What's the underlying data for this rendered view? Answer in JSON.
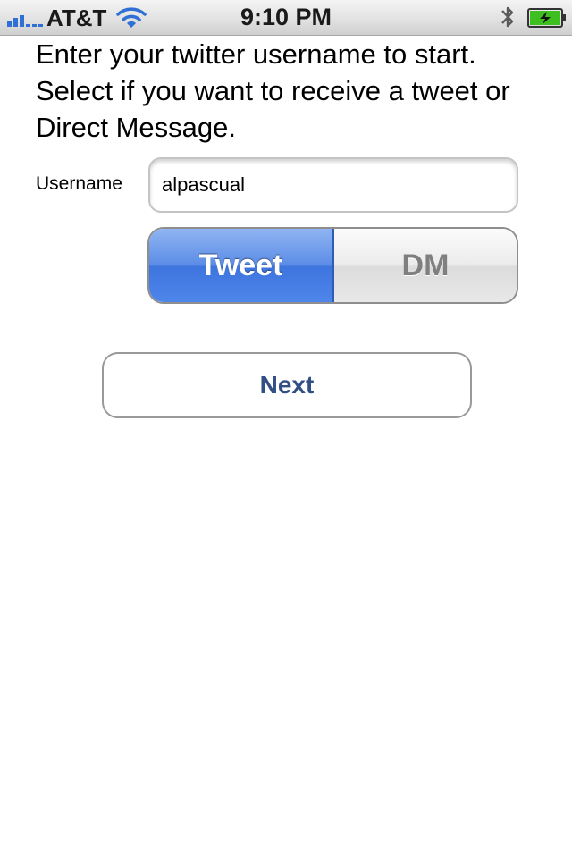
{
  "status_bar": {
    "carrier": "AT&T",
    "time": "9:10 PM",
    "signal_icon": "signal-bars-icon",
    "wifi_icon": "wifi-icon",
    "bluetooth_icon": "bluetooth-icon",
    "battery_icon": "battery-charging-icon",
    "battery_color": "#3cbf1f"
  },
  "instructions": "Enter your twitter username to start. Select if you want to receive a tweet or Direct Message.",
  "username": {
    "label": "Username",
    "value": "alpascual",
    "placeholder": ""
  },
  "segmented_control": {
    "selected": "Tweet",
    "options": [
      "Tweet",
      "DM"
    ],
    "selected_color": "#4f86ea"
  },
  "next_button": {
    "label": "Next",
    "color": "#324f85"
  }
}
